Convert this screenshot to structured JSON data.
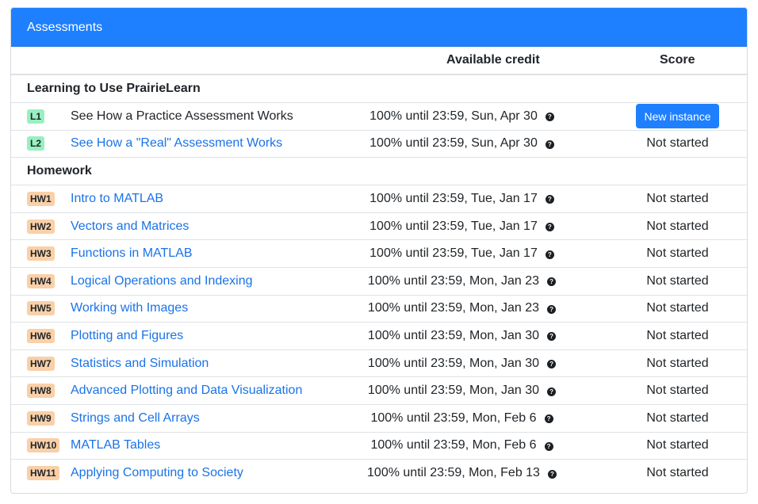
{
  "card": {
    "title": "Assessments"
  },
  "columns": {
    "credit": "Available credit",
    "score": "Score"
  },
  "groups": [
    {
      "name": "Learning to Use PrairieLearn",
      "rows": [
        {
          "badge": "L1",
          "badge_color": "green",
          "title": "See How a Practice Assessment Works",
          "is_link": false,
          "credit": "100% until 23:59, Sun, Apr 30",
          "score": "",
          "action": "New instance"
        },
        {
          "badge": "L2",
          "badge_color": "green",
          "title": "See How a \"Real\" Assessment Works",
          "is_link": true,
          "credit": "100% until 23:59, Sun, Apr 30",
          "score": "Not started"
        }
      ]
    },
    {
      "name": "Homework",
      "rows": [
        {
          "badge": "HW1",
          "badge_color": "orange",
          "title": "Intro to MATLAB",
          "is_link": true,
          "credit": "100% until 23:59, Tue, Jan 17",
          "score": "Not started"
        },
        {
          "badge": "HW2",
          "badge_color": "orange",
          "title": "Vectors and Matrices",
          "is_link": true,
          "credit": "100% until 23:59, Tue, Jan 17",
          "score": "Not started"
        },
        {
          "badge": "HW3",
          "badge_color": "orange",
          "title": "Functions in MATLAB",
          "is_link": true,
          "credit": "100% until 23:59, Tue, Jan 17",
          "score": "Not started"
        },
        {
          "badge": "HW4",
          "badge_color": "orange",
          "title": "Logical Operations and Indexing",
          "is_link": true,
          "credit": "100% until 23:59, Mon, Jan 23",
          "score": "Not started"
        },
        {
          "badge": "HW5",
          "badge_color": "orange",
          "title": "Working with Images",
          "is_link": true,
          "credit": "100% until 23:59, Mon, Jan 23",
          "score": "Not started"
        },
        {
          "badge": "HW6",
          "badge_color": "orange",
          "title": "Plotting and Figures",
          "is_link": true,
          "credit": "100% until 23:59, Mon, Jan 30",
          "score": "Not started"
        },
        {
          "badge": "HW7",
          "badge_color": "orange",
          "title": "Statistics and Simulation",
          "is_link": true,
          "credit": "100% until 23:59, Mon, Jan 30",
          "score": "Not started"
        },
        {
          "badge": "HW8",
          "badge_color": "orange",
          "title": "Advanced Plotting and Data Visualization",
          "is_link": true,
          "credit": "100% until 23:59, Mon, Jan 30",
          "score": "Not started"
        },
        {
          "badge": "HW9",
          "badge_color": "orange",
          "title": "Strings and Cell Arrays",
          "is_link": true,
          "credit": "100% until 23:59, Mon, Feb 6",
          "score": "Not started"
        },
        {
          "badge": "HW10",
          "badge_color": "orange",
          "title": "MATLAB Tables",
          "is_link": true,
          "credit": "100% until 23:59, Mon, Feb 6",
          "score": "Not started"
        },
        {
          "badge": "HW11",
          "badge_color": "orange",
          "title": "Applying Computing to Society",
          "is_link": true,
          "credit": "100% until 23:59, Mon, Feb 13",
          "score": "Not started"
        }
      ]
    }
  ],
  "colors": {
    "header_bg": "#1e7fff",
    "link": "#1a73e8",
    "badge_green": "#98f0c0",
    "badge_orange": "#f9d0a8"
  },
  "icons": {
    "help": "question-circle-icon"
  }
}
